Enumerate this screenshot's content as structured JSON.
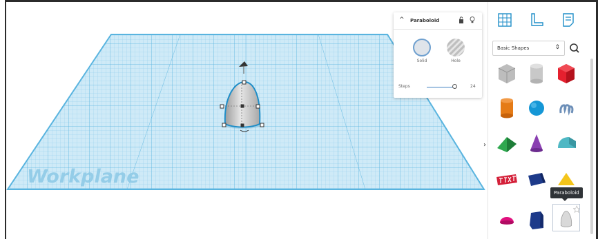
{
  "workplane": {
    "label": "Workplane"
  },
  "inspector": {
    "title": "Paraboloid",
    "solid_label": "Solid",
    "hole_label": "Hole",
    "steps_label": "Steps",
    "steps_value": "24"
  },
  "shapes_panel": {
    "category": "Basic Shapes",
    "tooltip": "Paraboloid"
  },
  "colors": {
    "grid": "#59b4df",
    "grid_fill": "#bfe4f5",
    "accent": "#1f8ec8",
    "shape_gray": "#d8d8d8",
    "box_red": "#e5202e",
    "cylinder_orange": "#e57b16",
    "sphere_blue": "#1597d6",
    "pyramid_green": "#2fa84f",
    "cone_purple": "#8a3fb1",
    "roof_yellow": "#f4c51b",
    "half_sphere_pink": "#e0107e",
    "polygon_navy": "#1d3a8a"
  }
}
